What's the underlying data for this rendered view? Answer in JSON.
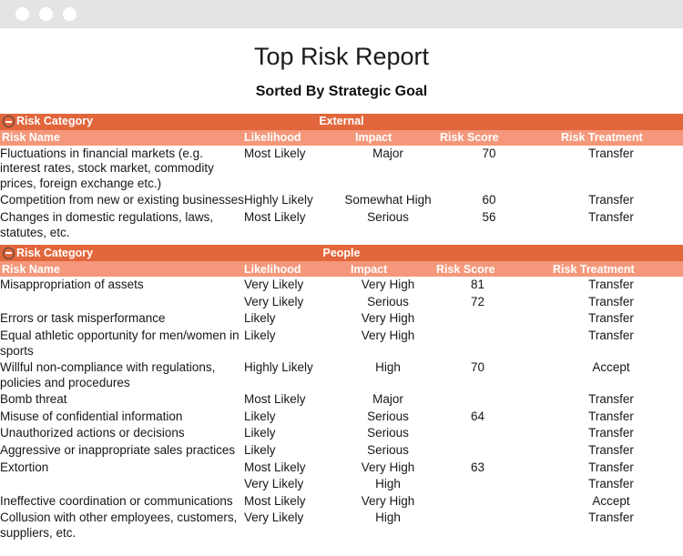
{
  "window": {
    "controls": [
      {
        "name": "window-dot-1"
      },
      {
        "name": "window-dot-2"
      },
      {
        "name": "window-dot-3"
      }
    ]
  },
  "report": {
    "title": "Top Risk Report",
    "subtitle": "Sorted By Strategic Goal",
    "colors": {
      "category_band": "#E2663C",
      "column_header_band": "#F4977A",
      "header_text": "#FFFFFF",
      "body_text": "#171717",
      "titlebar": "#E4E4E4",
      "page_background": "#FFFFFF"
    },
    "category_label": "Risk Category",
    "collapse_icon": "minus-circle-icon",
    "columns": [
      "Risk Name",
      "Likelihood",
      "Impact",
      "Risk Score",
      "Risk Treatment"
    ],
    "sections": [
      {
        "id": "external",
        "category_label": "Risk Category",
        "category_value": "External",
        "columns": [
          "Risk Name",
          "Likelihood",
          "Impact",
          "Risk Score",
          "Risk Treatment"
        ],
        "rows": [
          {
            "risk_name": "Fluctuations in financial markets (e.g. interest rates, stock market, commodity prices, foreign exchange etc.)",
            "likelihood": "Most Likely",
            "impact": "Major",
            "risk_score": "70",
            "risk_treatment": "Transfer"
          },
          {
            "risk_name": "Competition from new or existing businesses",
            "likelihood": "Highly Likely",
            "impact": "Somewhat High",
            "risk_score": "60",
            "risk_treatment": "Transfer"
          },
          {
            "risk_name": "Changes in domestic regulations, laws, statutes, etc.",
            "likelihood": "Most Likely",
            "impact": "Serious",
            "risk_score": "56",
            "risk_treatment": "Transfer"
          }
        ]
      },
      {
        "id": "people",
        "category_label": "Risk Category",
        "category_value": "People",
        "columns": [
          "Risk Name",
          "Likelihood",
          "Impact",
          "Risk Score",
          "Risk Treatment"
        ],
        "rows": [
          {
            "risk_name": "Misappropriation of assets",
            "likelihood": "Very Likely",
            "impact": "Very High",
            "risk_score": "81",
            "risk_treatment": "Transfer"
          },
          {
            "risk_name": "",
            "likelihood": "Very Likely",
            "impact": "Serious",
            "risk_score": "72",
            "risk_treatment": "Transfer"
          },
          {
            "risk_name": "Errors or task misperformance",
            "likelihood": "Likely",
            "impact": "Very High",
            "risk_score": "",
            "risk_treatment": "Transfer"
          },
          {
            "risk_name": "Equal athletic opportunity for men/women in sports",
            "likelihood": "Likely",
            "impact": "Very High",
            "risk_score": "",
            "risk_treatment": "Transfer"
          },
          {
            "risk_name": "Willful non-compliance with regulations, policies and procedures",
            "likelihood": "Highly Likely",
            "impact": "High",
            "risk_score": "70",
            "risk_treatment": "Accept"
          },
          {
            "risk_name": "Bomb threat",
            "likelihood": "Most Likely",
            "impact": "Major",
            "risk_score": "",
            "risk_treatment": "Transfer"
          },
          {
            "risk_name": "Misuse of confidential information",
            "likelihood": "Likely",
            "impact": "Serious",
            "risk_score": "64",
            "risk_treatment": "Transfer"
          },
          {
            "risk_name": "Unauthorized actions or decisions",
            "likelihood": "Likely",
            "impact": "Serious",
            "risk_score": "",
            "risk_treatment": "Transfer"
          },
          {
            "risk_name": "Aggressive or inappropriate sales practices",
            "likelihood": "Likely",
            "impact": "Serious",
            "risk_score": "",
            "risk_treatment": "Transfer"
          },
          {
            "risk_name": "Extortion",
            "likelihood": "Most Likely",
            "impact": "Very High",
            "risk_score": "63",
            "risk_treatment": "Transfer"
          },
          {
            "risk_name": "",
            "likelihood": "Very Likely",
            "impact": "High",
            "risk_score": "",
            "risk_treatment": "Transfer"
          },
          {
            "risk_name": "Ineffective coordination or communications",
            "likelihood": "Most Likely",
            "impact": "Very High",
            "risk_score": "",
            "risk_treatment": "Accept"
          },
          {
            "risk_name": "Collusion with other employees, customers, suppliers, etc.",
            "likelihood": "Very Likely",
            "impact": "High",
            "risk_score": "",
            "risk_treatment": "Transfer"
          }
        ]
      }
    ]
  }
}
